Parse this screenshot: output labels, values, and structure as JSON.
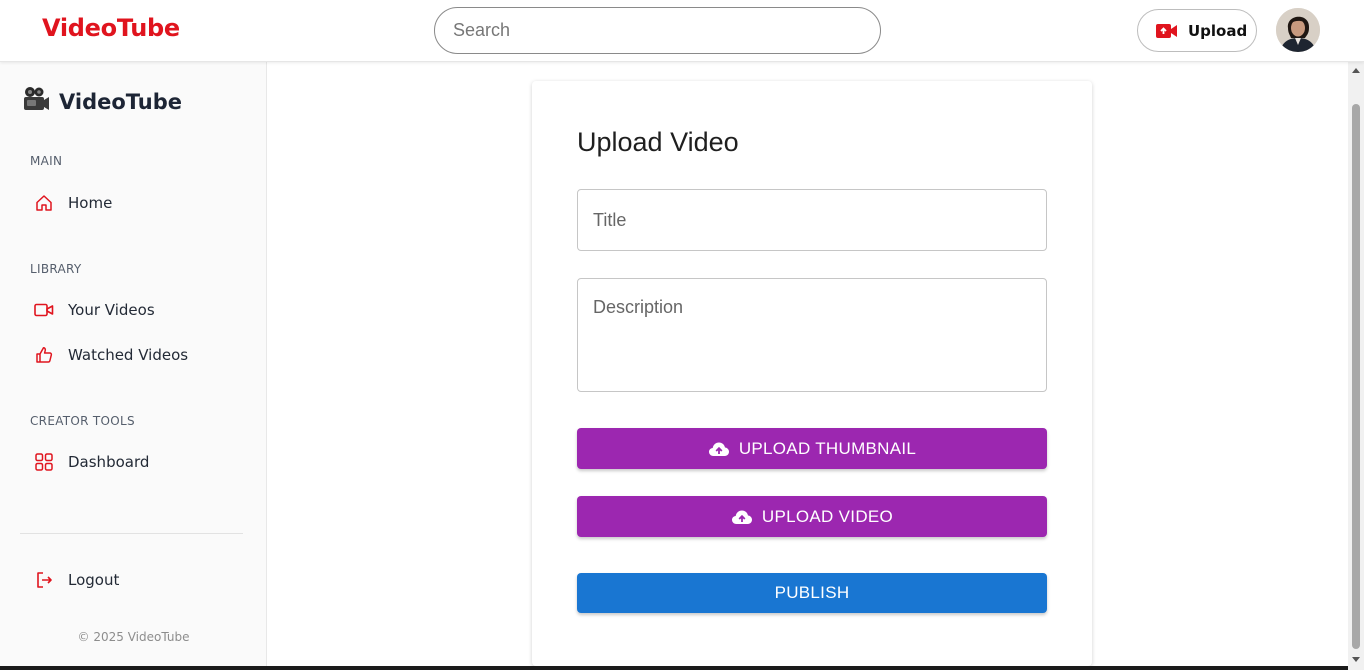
{
  "header": {
    "brand": "VideoTube",
    "search_placeholder": "Search",
    "upload_label": "Upload"
  },
  "sidebar": {
    "brand": "VideoTube",
    "sections": {
      "main": "MAIN",
      "library": "LIBRARY",
      "creator_tools": "CREATOR TOOLS"
    },
    "items": {
      "home": "Home",
      "your_videos": "Your Videos",
      "watched_videos": "Watched Videos",
      "dashboard": "Dashboard",
      "logout": "Logout"
    },
    "copyright": "© 2025 VideoTube"
  },
  "form": {
    "heading": "Upload Video",
    "title_placeholder": "Title",
    "description_placeholder": "Description",
    "upload_thumbnail": "UPLOAD THUMBNAIL",
    "upload_video": "UPLOAD VIDEO",
    "publish": "PUBLISH"
  },
  "colors": {
    "brand_red": "#e0141e",
    "purple": "#9c27b0",
    "blue": "#1976d2"
  }
}
